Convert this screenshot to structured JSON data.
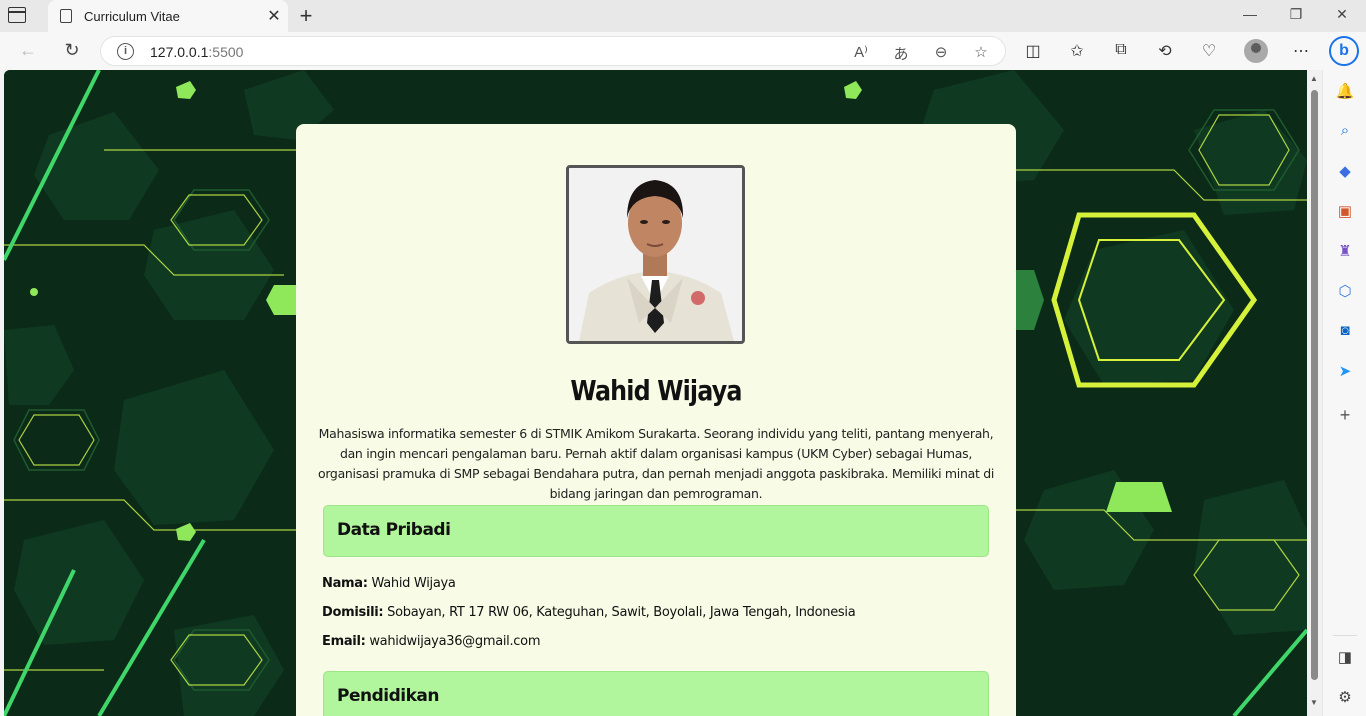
{
  "browser": {
    "tab_title": "Curriculum Vitae",
    "url_host": "127.0.0.1",
    "url_port": ":5500",
    "bing_label": "b"
  },
  "cv": {
    "name": "Wahid Wijaya",
    "bio": "Mahasiswa informatika semester 6 di STMIK Amikom Surakarta. Seorang individu yang teliti, pantang menyerah, dan ingin mencari pengalaman baru. Pernah aktif dalam organisasi kampus (UKM Cyber) sebagai Humas, organisasi pramuka di SMP sebagai Bendahara putra, dan pernah menjadi anggota paskibraka. Memiliki minat di bidang jaringan dan pemrograman.",
    "section_personal": "Data Pribadi",
    "nama_label": "Nama:",
    "nama_value": " Wahid Wijaya",
    "domisili_label": "Domisili:",
    "domisili_value": " Sobayan, RT 17 RW 06, Kateguhan, Sawit, Boyolali, Jawa Tengah, Indonesia",
    "email_label": "Email:",
    "email_value": " wahidwijaya36@gmail.com",
    "section_education": "Pendidikan"
  },
  "colors": {
    "card_bg": "#f8fce6",
    "section_bg": "#b1f59c",
    "page_bg": "#0b2e1a",
    "neon": "#c8f04a"
  }
}
